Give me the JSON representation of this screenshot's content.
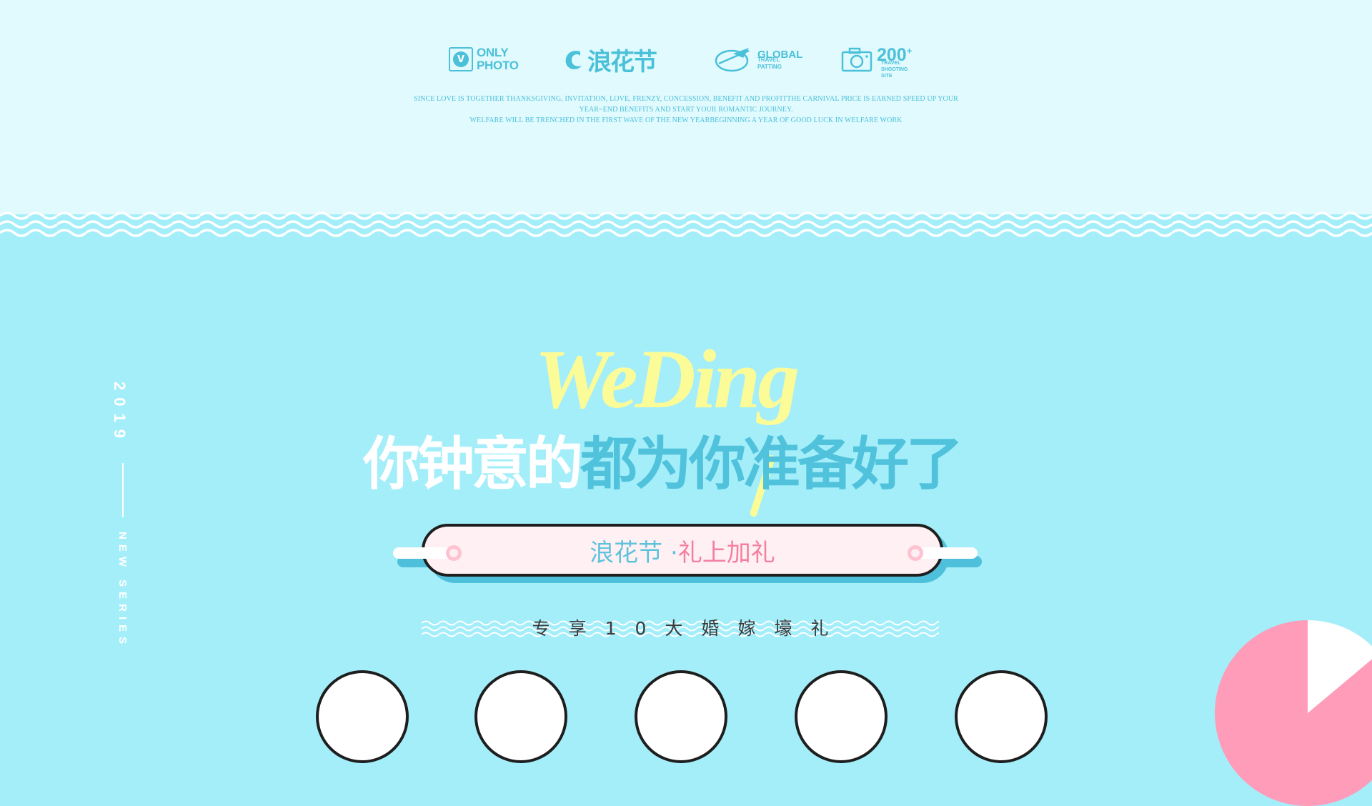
{
  "colors": {
    "top_band": "#e1fafe",
    "main_background": "#a4eefa",
    "brand_blue": "#4bc0d9",
    "script_yellow": "#fbfb98",
    "pink": "#f47fa2",
    "pill_fill": "#fff0f3"
  },
  "header": {
    "logos": {
      "only_photo": {
        "badge": "V",
        "line1": "ONLY",
        "line2": "PHOTO",
        "icon": "v-badge-icon"
      },
      "lanhua": {
        "brand": "浪花节",
        "icon": "wave-curl-icon"
      },
      "global": {
        "title": "GLOBAL",
        "sub1": "TRAVEL",
        "sub2": "PATTING",
        "icon": "globe-plane-icon"
      },
      "count": {
        "number": "200",
        "sup": "+",
        "sub1": "TRAVEL",
        "sub2": "SHOOTING SITE",
        "icon": "camera-icon"
      }
    },
    "tagline": [
      "SINCE LOVE IS TOGETHER THANKSGIVING, INVITATION, LOVE, FRENZY, CONCESSION, BENEFIT AND PROFITTHE CARNIVAL PRICE IS EARNED SPEED UP YOUR",
      "YEAR~END BENEFITS AND START YOUR ROMANTIC JOURNEY.",
      "WELFARE WILL BE TRENCHED IN THE FIRST WAVE OF THE NEW YEARBEGINNING A YEAR OF GOOD LUCK IN WELFARE WORK"
    ]
  },
  "side": {
    "year": "2019",
    "series": "NEW SERIES"
  },
  "hero": {
    "script_word": "WeDing",
    "headline_white": "你钟意的",
    "headline_blue": "都为你准备好了",
    "pill_left": "浪花节 · ",
    "pill_right": "礼上加礼",
    "subtitle": "专享10大婚嫁壕礼"
  }
}
